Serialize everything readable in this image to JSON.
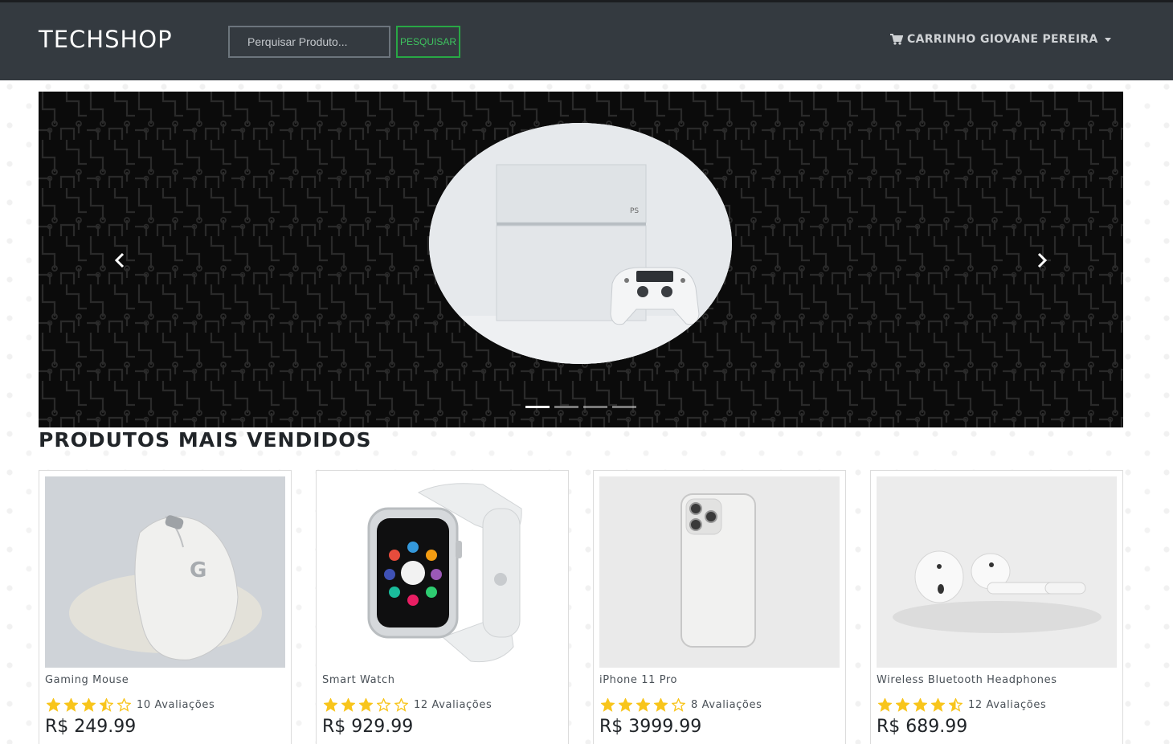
{
  "navbar": {
    "brand": "TECHSHOP",
    "search_placeholder": "Perquisar Produto...",
    "search_button": "PESQUISAR",
    "cart_label": "CARRINHO",
    "user_label": "GIOVANE PEREIRA",
    "cart_icon": "shopping-cart-icon"
  },
  "carousel": {
    "active_slide": 1,
    "slide_count": 4,
    "prev_icon": "chevron-left-icon",
    "next_icon": "chevron-right-icon"
  },
  "section": {
    "title": "PRODUTOS MAIS VENDIDOS"
  },
  "products": [
    {
      "name": "Gaming Mouse",
      "rating": 3.5,
      "reviews": "10 Avaliações",
      "price": "R$ 249.99"
    },
    {
      "name": "Smart Watch",
      "rating": 3,
      "reviews": "12 Avaliações",
      "price": "R$ 929.99"
    },
    {
      "name": "iPhone 11 Pro",
      "rating": 4,
      "reviews": "8 Avaliações",
      "price": "R$ 3999.99"
    },
    {
      "name": "Wireless Bluetooth Headphones",
      "rating": 4.5,
      "reviews": "12 Avaliações",
      "price": "R$ 689.99"
    }
  ],
  "colors": {
    "navbar": "#343a40",
    "accent_green": "#28a745",
    "star": "#f8c51c"
  }
}
